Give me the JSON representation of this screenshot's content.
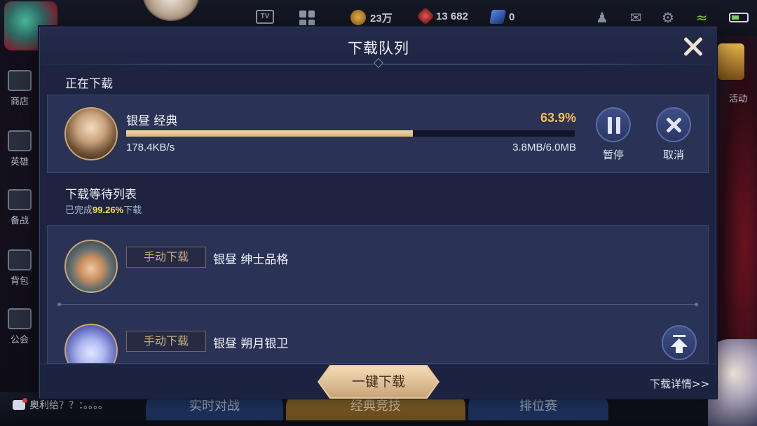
{
  "status_bar": {
    "gold": "23万",
    "gems": "13 682",
    "tickets": "0"
  },
  "colors": {
    "accent_gold": "#f2c04a",
    "highlight_yellow": "#f7e04a",
    "progress_fill": "#dcb27a",
    "modal_bg": "#1e2440"
  },
  "left_menu": [
    "商店",
    "英雄",
    "备战",
    "背包",
    "公会"
  ],
  "right_menu": {
    "activity": "活动"
  },
  "chat": {
    "text": "奥利给？？：。。。。"
  },
  "bottom_modes": [
    "实时对战",
    "经典竞技",
    "排位赛"
  ],
  "modal": {
    "title": "下载队列",
    "close_icon": "close-icon",
    "downloading": {
      "section_title": "正在下载",
      "hero_name": "银昼 经典",
      "percent_label": "63.9%",
      "progress": 0.639,
      "speed": "178.4KB/s",
      "size": "3.8MB/6.0MB",
      "pause_label": "暂停",
      "cancel_label": "取消"
    },
    "queue": {
      "section_title": "下载等待列表",
      "completed_prefix": "已完成",
      "completed_value": "99.26%",
      "completed_suffix": "下载",
      "items": [
        {
          "manual_label": "手动下载",
          "hero_name": "银昼 绅士品格"
        },
        {
          "manual_label": "手动下载",
          "hero_name": "银昼 朔月银卫"
        }
      ]
    },
    "footer": {
      "one_click_label": "一键下载",
      "details_link": "下载详情>>"
    }
  }
}
